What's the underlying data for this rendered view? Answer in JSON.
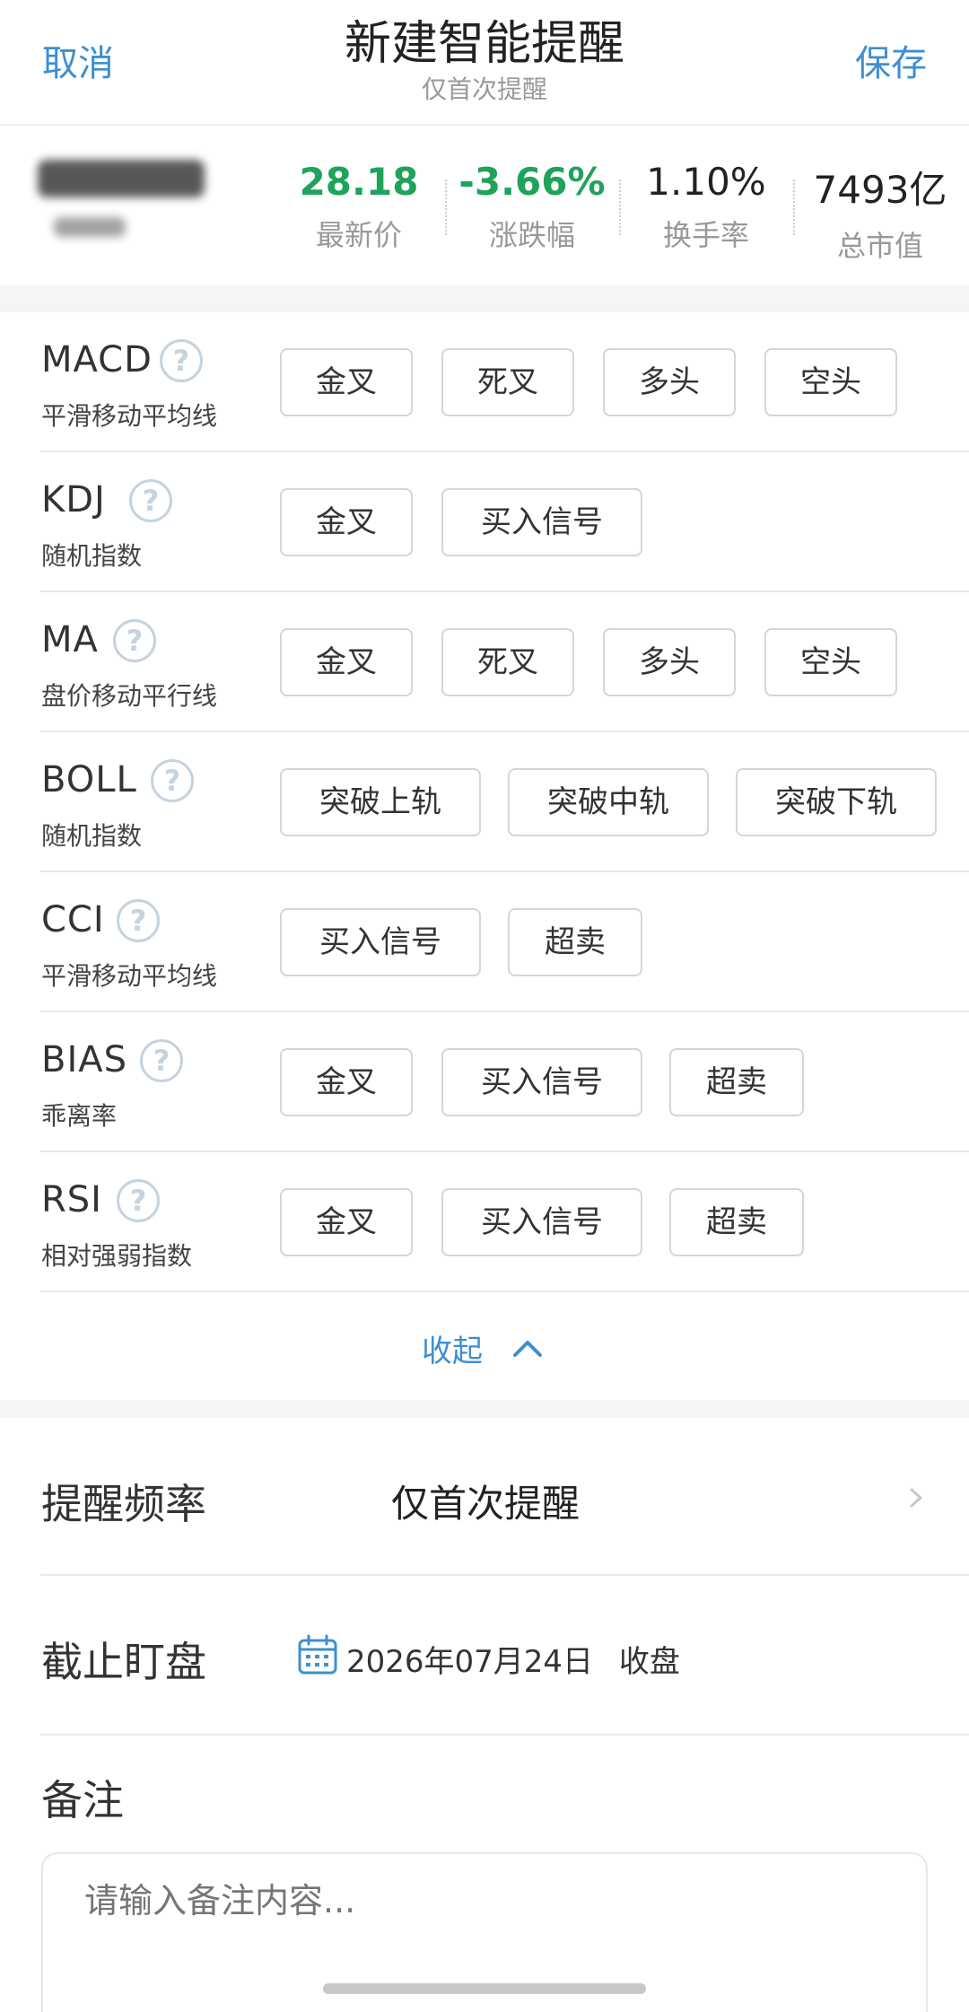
{
  "header": {
    "cancel": "取消",
    "title": "新建智能提醒",
    "subtitle": "仅首次提醒",
    "save": "保存"
  },
  "stock": {
    "metrics": [
      {
        "value": "28.18",
        "label": "最新价",
        "color": "#1fa35b"
      },
      {
        "value": "-3.66%",
        "label": "涨跌幅",
        "color": "#1fa35b"
      },
      {
        "value": "1.10%",
        "label": "换手率"
      },
      {
        "value": "7493亿",
        "label": "总市值"
      }
    ]
  },
  "indicators": [
    {
      "name": "MACD",
      "desc": "平滑移动平均线",
      "tags": [
        "金叉",
        "死叉",
        "多头",
        "空头"
      ]
    },
    {
      "name": "KDJ",
      "desc": "随机指数",
      "tags": [
        "金叉",
        "买入信号"
      ]
    },
    {
      "name": "MA",
      "desc": "盘价移动平行线",
      "tags": [
        "金叉",
        "死叉",
        "多头",
        "空头"
      ]
    },
    {
      "name": "BOLL",
      "desc": "随机指数",
      "tags": [
        "突破上轨",
        "突破中轨",
        "突破下轨"
      ]
    },
    {
      "name": "CCI",
      "desc": "平滑移动平均线",
      "tags": [
        "买入信号",
        "超卖"
      ]
    },
    {
      "name": "BIAS",
      "desc": "乖离率",
      "tags": [
        "金叉",
        "买入信号",
        "超卖"
      ]
    },
    {
      "name": "RSI",
      "desc": "相对强弱指数",
      "tags": [
        "金叉",
        "买入信号",
        "超卖"
      ]
    }
  ],
  "collapse_label": "收起",
  "settings": {
    "freq_label": "提醒频率",
    "freq_value": "仅首次提醒",
    "until_label": "截止盯盘",
    "until_date": "2026年07月24日",
    "until_time": "收盘",
    "remark_label": "备注",
    "remark_placeholder": "请输入备注内容..."
  },
  "colors": {
    "accent": "#3d8fd1",
    "down": "#1fa35b"
  }
}
